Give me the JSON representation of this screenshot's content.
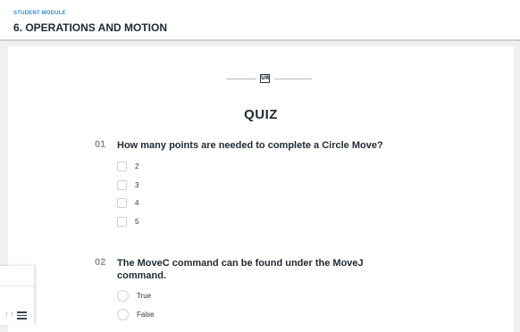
{
  "header": {
    "module_label": "STUDENT MODULE",
    "title": "6. OPERATIONS AND MOTION"
  },
  "divider": {
    "logo_text": "UR"
  },
  "quiz": {
    "title": "QUIZ",
    "questions": [
      {
        "number": "01",
        "text": "How many points are needed to complete a Circle Move?",
        "type": "checkbox",
        "options": [
          "2",
          "3",
          "4",
          "5"
        ]
      },
      {
        "number": "02",
        "text": "The MoveC command can be found under the MoveJ command.",
        "type": "radio",
        "options": [
          "True",
          "False"
        ]
      }
    ]
  },
  "icons": {
    "logo": "ur-logo-icon",
    "menu": "hamburger-menu-icon",
    "expand": "expand-arrows-icon"
  },
  "colors": {
    "accent": "#2e8fd6",
    "background": "#eef0f2",
    "title_text": "#1f2a33",
    "question_number": "#8a939b"
  }
}
